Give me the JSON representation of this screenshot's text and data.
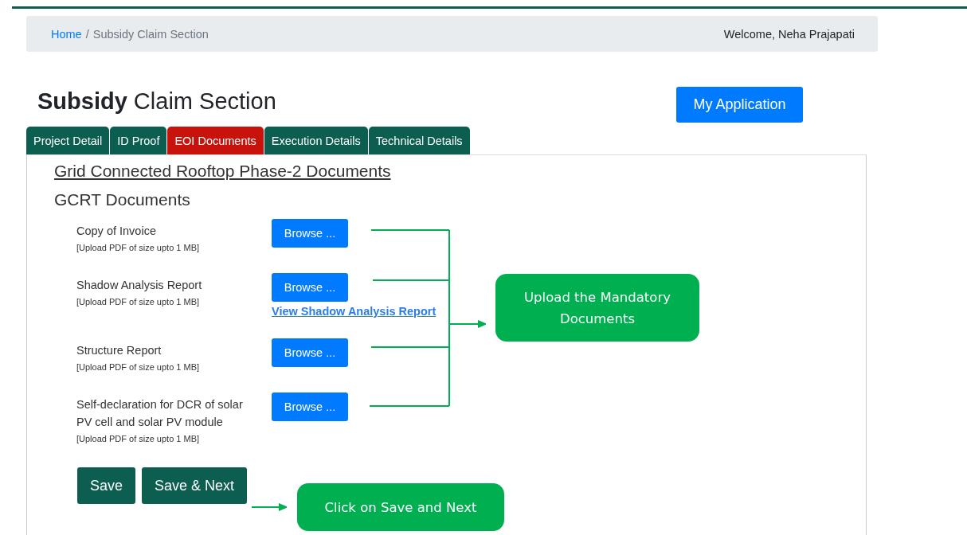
{
  "breadcrumb": {
    "items": [
      {
        "label": "Home",
        "kind": "link"
      },
      {
        "label": "Subsidy Claim Section",
        "kind": "current"
      }
    ],
    "separator": "/",
    "welcome": "Welcome, Neha Prajapati"
  },
  "page_title": "**Subsidy** Claim Section",
  "my_application_button": "My Application",
  "tabs": [
    {
      "label": "Project Detail",
      "selected": false
    },
    {
      "label": "ID Proof",
      "selected": false
    },
    {
      "label": "EOI Documents",
      "selected": true
    },
    {
      "label": "Execution Details",
      "selected": false
    },
    {
      "label": "Technical Details",
      "selected": false
    }
  ],
  "section_heading": "Grid Connected Rooftop Phase-2 Documents",
  "subheading": "GCRT Documents",
  "documents": [
    {
      "label": "Copy of Invoice",
      "hint": "[Upload PDF of size upto 1 MB]",
      "button": "Browse ..."
    },
    {
      "label": "Shadow Analysis Report",
      "hint": "[Upload PDF of size upto 1 MB]",
      "button": "Browse ...",
      "link": "View Shadow Analysis Report"
    },
    {
      "label": "Structure Report",
      "hint": "[Upload PDF of size upto 1 MB]",
      "button": "Browse ..."
    },
    {
      "label": "Self-declaration for DCR of solar PV cell and solar PV module",
      "hint": "[Upload PDF of size upto 1 MB]",
      "button": "Browse ..."
    }
  ],
  "actions": [
    "Save",
    "Save & Next"
  ],
  "annotations": {
    "upload_callout": "Upload the Mandatory Documents",
    "save_callout": "Click on Save and Next"
  }
}
